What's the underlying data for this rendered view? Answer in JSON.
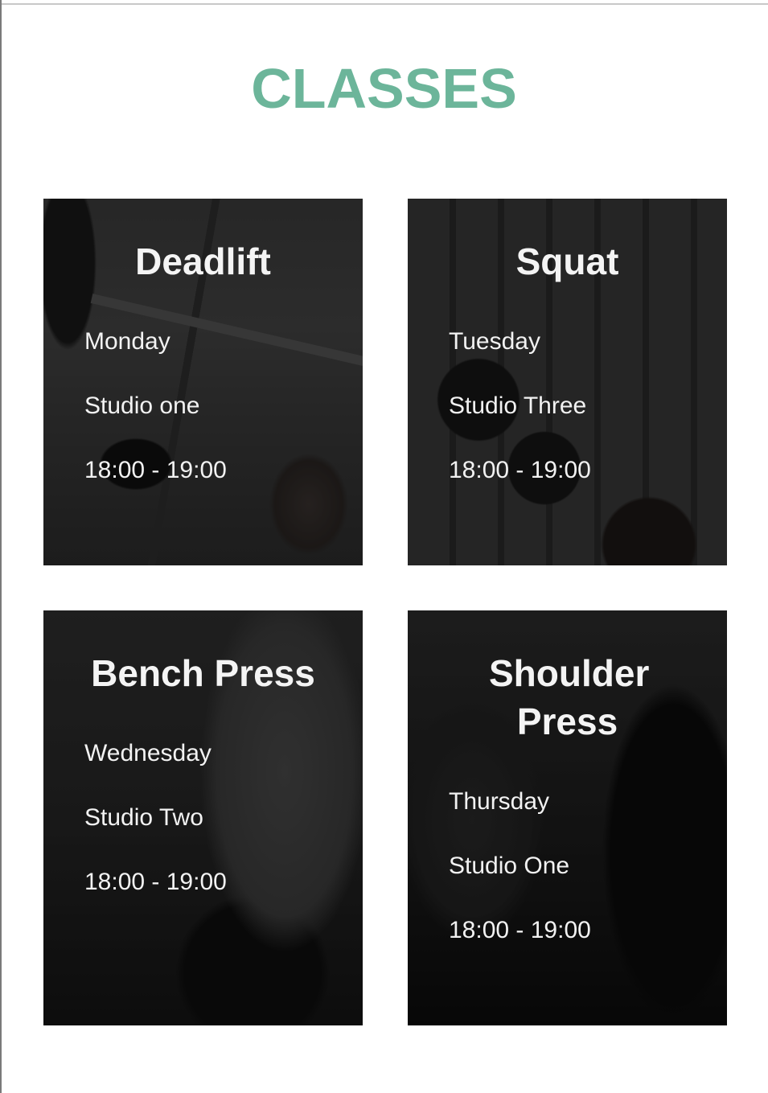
{
  "page": {
    "title": "CLASSES"
  },
  "colors": {
    "accent": "#6cb59a",
    "card_text": "#ffffff",
    "background": "#ffffff"
  },
  "classes": [
    {
      "name": "Deadlift",
      "day": "Monday",
      "studio": "Studio one",
      "time": "18:00 - 19:00"
    },
    {
      "name": "Squat",
      "day": "Tuesday",
      "studio": "Studio Three",
      "time": "18:00 - 19:00"
    },
    {
      "name": "Bench Press",
      "day": "Wednesday",
      "studio": "Studio Two",
      "time": "18:00 - 19:00"
    },
    {
      "name": "Shoulder Press",
      "day": "Thursday",
      "studio": "Studio One",
      "time": "18:00 - 19:00"
    }
  ]
}
